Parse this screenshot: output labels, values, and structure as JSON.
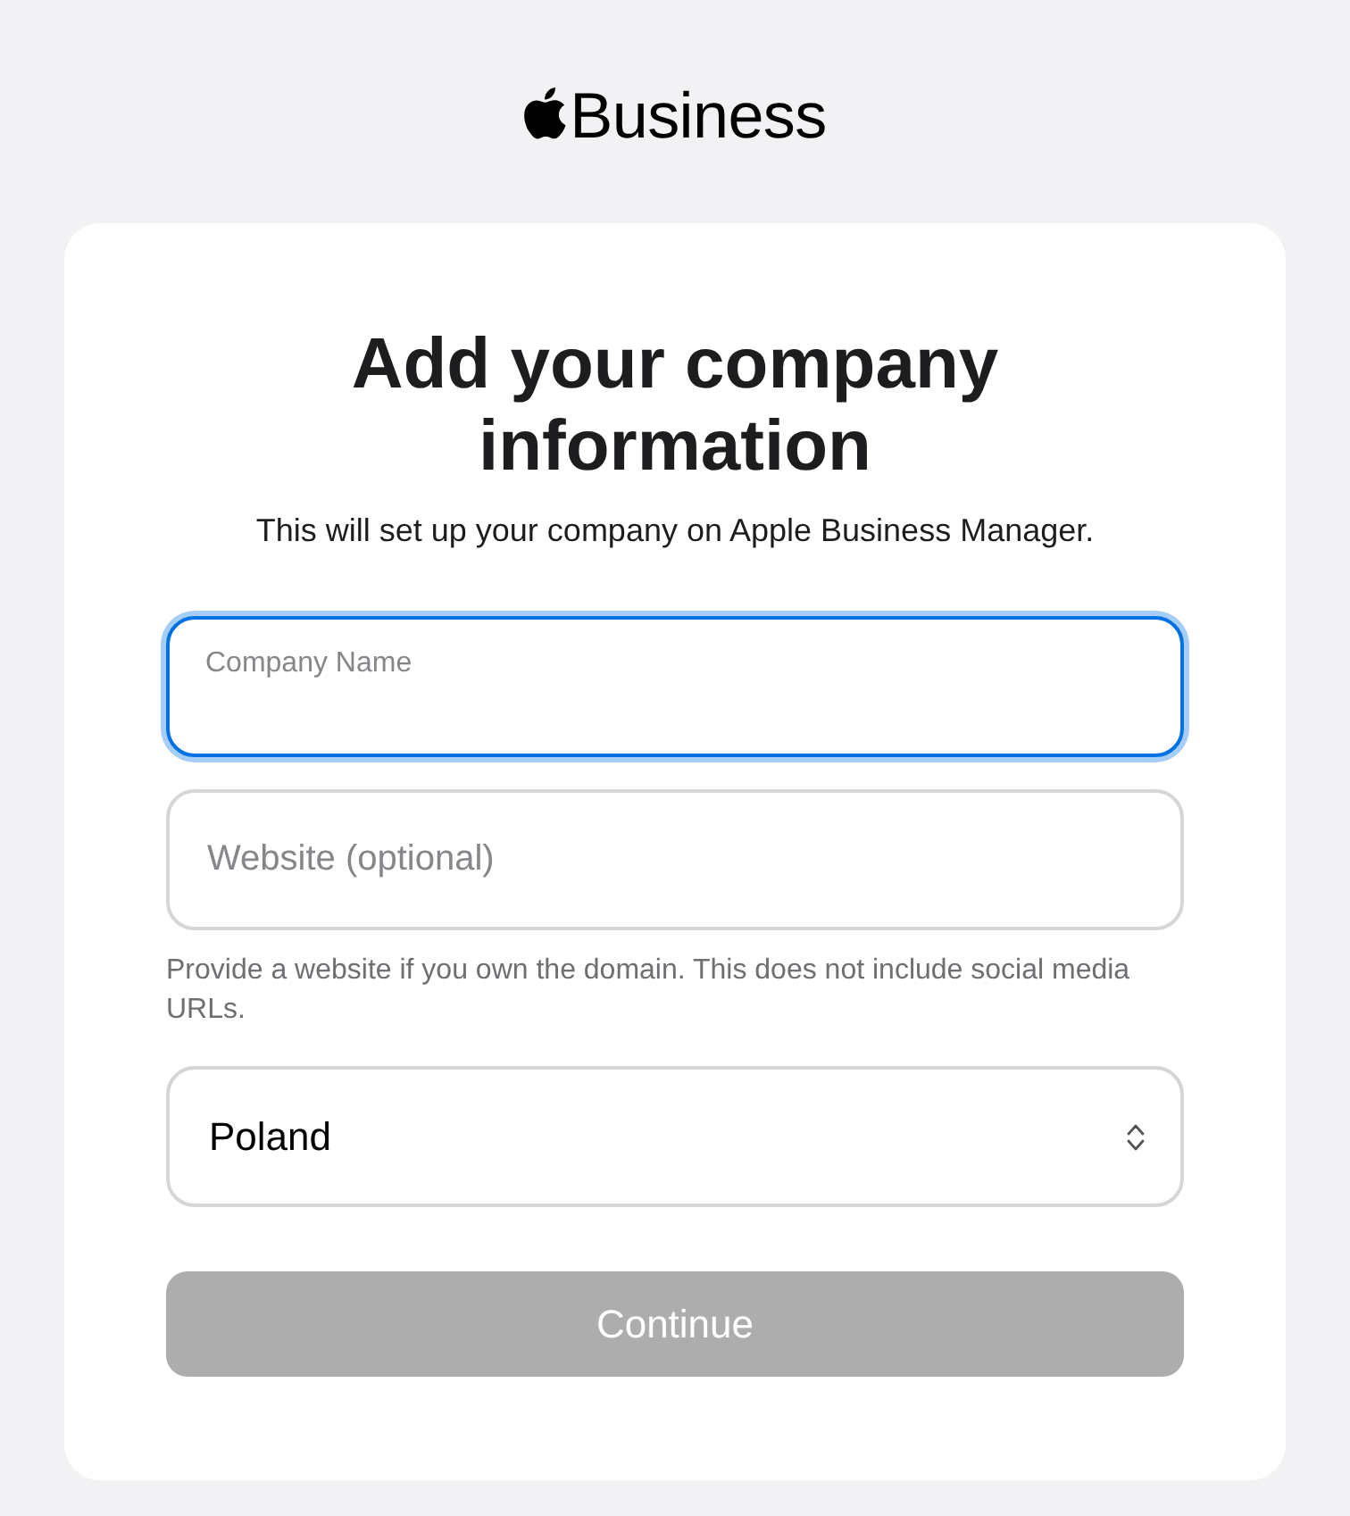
{
  "header": {
    "logo_text": "Business"
  },
  "form": {
    "title": "Add your company information",
    "subtitle": "This will set up your company on Apple Business Manager.",
    "fields": [
      {
        "kind": "text",
        "label": "Company Name",
        "focused": true
      },
      {
        "kind": "text",
        "placeholder": "Website (optional)",
        "focused": false
      }
    ],
    "help_text": "Provide a website if you own the domain. This does not include social media URLs.",
    "country_select": {
      "value": "Poland"
    },
    "continue_button": {
      "label": "Continue",
      "disabled": true
    }
  }
}
